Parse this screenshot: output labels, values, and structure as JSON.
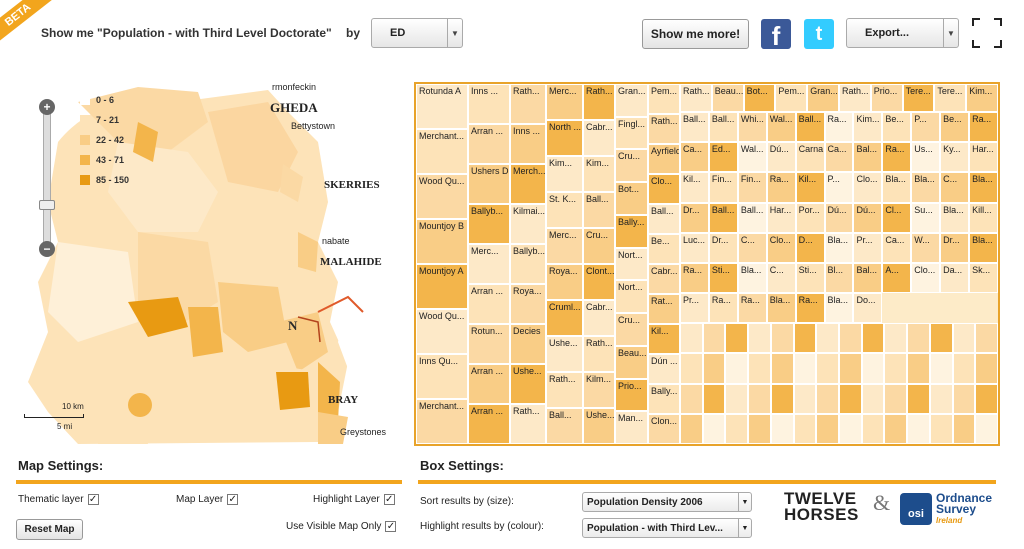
{
  "beta": "BETA",
  "header": {
    "show_me": "Show me \"Population - with Third Level Doctorate\"",
    "by": "by",
    "area_select": "ED",
    "show_more": "Show me more!",
    "export": "Export..."
  },
  "legend": [
    {
      "label": "0 - 6",
      "color": "#ffffff"
    },
    {
      "label": "7 - 21",
      "color": "#fde3b8"
    },
    {
      "label": "22 - 42",
      "color": "#f9cd86"
    },
    {
      "label": "43 - 71",
      "color": "#f3b54b"
    },
    {
      "label": "85 - 150",
      "color": "#e89a12"
    }
  ],
  "map_places": {
    "termonfeckin": "rmonfeckin",
    "drogheda": "GHEDA",
    "bettystown": "Bettystown",
    "skerries": "SKERRIES",
    "malahide": "MALAHIDE",
    "portmarnock": "nabate",
    "bray": "BRAY",
    "greystones": "Greystones",
    "dublin": "N"
  },
  "scale": {
    "km": "10 km",
    "mi": "5 mi"
  },
  "treemap": {
    "cells_col1": [
      "Rotunda A",
      "Merchant...",
      "Wood Qu...",
      "Mountjoy B",
      "Mountjoy A",
      "Wood Qu...",
      "Inns Qu...",
      "Merchant..."
    ],
    "cells_col2": [
      "Inns ...",
      "Arran ...",
      "Ushers D",
      "Ballyb...",
      "Merc...",
      "Arran ...",
      "Rotun...",
      "Arran ...",
      "Arran ..."
    ],
    "cells_col3": [
      "Rath...",
      "Inns ...",
      "Merch...",
      "Kilmai...",
      "Ballyb...",
      "Roya...",
      "Decies",
      "Ushe...",
      "Rath..."
    ],
    "cells_col4": [
      "Merc...",
      "North ...",
      "Kim...",
      "St. K...",
      "Merc...",
      "Roya...",
      "Cruml...",
      "Ushe...",
      "Rath...",
      "Ball..."
    ],
    "cells_col5": [
      "Rath...",
      "Cabr...",
      "Kim...",
      "Ball...",
      "Cru...",
      "Clont...",
      "Cabr...",
      "Rath...",
      "Kilm...",
      "Ushe..."
    ],
    "cells_col6": [
      "Gran...",
      "Fingl...",
      "Cru...",
      "Bot...",
      "Bally...",
      "Nort...",
      "Nort...",
      "Cru...",
      "Beau...",
      "Prio...",
      "Man..."
    ],
    "cells_col7": [
      "Pem...",
      "Rath...",
      "Ayrfield",
      "Clo...",
      "Ball...",
      "Be...",
      "Cabr...",
      "Rat...",
      "Kil...",
      "Dún ...",
      "Bally...",
      "Clon..."
    ],
    "row_top": [
      "Rath...",
      "Beau...",
      "Bot...",
      "Pem...",
      "Gran...",
      "Rath...",
      "Prio...",
      "Tere...",
      "Tere...",
      "Kim..."
    ],
    "misc": [
      "Ball...",
      "Ball...",
      "Whi...",
      "Wal...",
      "Ball...",
      "Ra...",
      "Kim...",
      "Be...",
      "P...",
      "Be...",
      "Ra...",
      "Ca...",
      "Ed...",
      "Wal...",
      "Dú...",
      "Carna",
      "Ca...",
      "Bal...",
      "Ra...",
      "Us...",
      "Ky...",
      "Har...",
      "Kil...",
      "Fin...",
      "Fin...",
      "Ra...",
      "Kil...",
      "P...",
      "Clo...",
      "Bla...",
      "Bla...",
      "C...",
      "Bla...",
      "Dr...",
      "Ball...",
      "Ball...",
      "Har...",
      "Por...",
      "Dú...",
      "Dú...",
      "Cl...",
      "Su...",
      "Bla...",
      "Kill...",
      "Luc...",
      "Dr...",
      "C...",
      "Clo...",
      "D...",
      "Bla...",
      "Pr...",
      "Ca...",
      "W...",
      "Dr...",
      "Bla...",
      "Ra...",
      "Sti...",
      "Bla...",
      "C...",
      "Sti...",
      "Bl...",
      "Bal...",
      "A...",
      "Clo...",
      "Da...",
      "Sk...",
      "Pr...",
      "Ra...",
      "Ra...",
      "Bla...",
      "Ra...",
      "Bla...",
      "Do..."
    ]
  },
  "map_settings": {
    "title": "Map Settings:",
    "thematic": "Thematic layer",
    "map_layer": "Map Layer",
    "highlight": "Highlight Layer",
    "visible_only": "Use Visible Map Only",
    "reset": "Reset Map"
  },
  "box_settings": {
    "title": "Box Settings:",
    "sort_label": "Sort results by (size):",
    "sort_value": "Population Density 2006",
    "highlight_label": "Highlight results by (colour):",
    "highlight_value": "Population - with Third Lev..."
  },
  "logos": {
    "twelve": "TWELVE",
    "horses": "HORSES",
    "amp": "&",
    "osi": "osi",
    "osi_line1": "Ordnance",
    "osi_line2": "Survey",
    "osi_line3": "Ireland"
  },
  "colors": {
    "accent": "#f2a51d",
    "fb": "#3b5998",
    "tw": "#33ccff"
  }
}
